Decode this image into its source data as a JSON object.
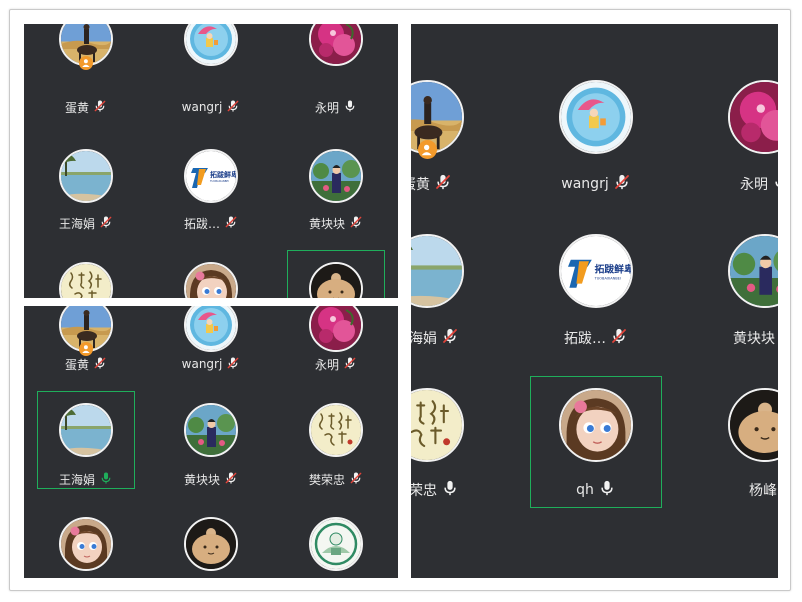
{
  "panels": {
    "top_left": {
      "rows": [
        [
          {
            "name": "蛋黄",
            "avatar": "rider-horse",
            "mic": "muted",
            "badge": true
          },
          {
            "name": "wangrj",
            "avatar": "umbrella-girl",
            "mic": "muted"
          },
          {
            "name": "永明",
            "avatar": "pink-flowers",
            "mic": "on"
          }
        ],
        [
          {
            "name": "王海娟",
            "avatar": "lake-trees",
            "mic": "muted"
          },
          {
            "name": "拓跋…",
            "avatar": "tuoba-logo",
            "mic": "muted"
          },
          {
            "name": "黄块块",
            "avatar": "woman-garden",
            "mic": "muted"
          }
        ],
        [
          {
            "name": "",
            "avatar": "calligraphy",
            "mic": "none"
          },
          {
            "name": "",
            "avatar": "cartoon-girl",
            "mic": "none"
          },
          {
            "name": "",
            "avatar": "clay-doll",
            "mic": "none",
            "speaking": true
          }
        ]
      ]
    },
    "bottom_left": {
      "rows": [
        [
          {
            "name": "蛋黄",
            "avatar": "rider-horse",
            "mic": "muted",
            "badge": true
          },
          {
            "name": "wangrj",
            "avatar": "umbrella-girl",
            "mic": "muted"
          },
          {
            "name": "永明",
            "avatar": "pink-flowers",
            "mic": "muted"
          }
        ],
        [
          {
            "name": "王海娟",
            "avatar": "lake-trees",
            "mic": "active",
            "speaking": true
          },
          {
            "name": "黄块块",
            "avatar": "woman-garden",
            "mic": "muted"
          },
          {
            "name": "樊荣忠",
            "avatar": "calligraphy",
            "mic": "muted"
          }
        ],
        [
          {
            "name": "",
            "avatar": "cartoon-girl",
            "mic": "none"
          },
          {
            "name": "",
            "avatar": "clay-doll",
            "mic": "none"
          },
          {
            "name": "",
            "avatar": "seal-illustration",
            "mic": "none"
          }
        ]
      ]
    },
    "right": {
      "rows": [
        [
          {
            "name": "蛋黄",
            "avatar": "rider-horse",
            "mic": "muted",
            "badge": true
          },
          {
            "name": "wangrj",
            "avatar": "umbrella-girl",
            "mic": "muted"
          },
          {
            "name": "永明",
            "avatar": "pink-flowers",
            "mic": "on"
          }
        ],
        [
          {
            "name": "王海娟",
            "avatar": "lake-trees",
            "mic": "muted"
          },
          {
            "name": "拓跋…",
            "avatar": "tuoba-logo",
            "mic": "muted"
          },
          {
            "name": "黄块块",
            "avatar": "woman-garden",
            "mic": "on"
          }
        ],
        [
          {
            "name": "樊荣忠",
            "avatar": "calligraphy",
            "mic": "on"
          },
          {
            "name": "qh",
            "avatar": "cartoon-girl",
            "mic": "on",
            "speaking": true
          },
          {
            "name": "杨峰",
            "avatar": "clay-doll",
            "mic": "none"
          }
        ]
      ]
    }
  },
  "logo_text": {
    "cn": "拓跋鲜卑",
    "en": "TUOBAXIANBEI"
  },
  "colors": {
    "panel_bg": "#2d2f33",
    "speaking_border": "#1fae5b",
    "muted_red": "#e0433a",
    "badge_orange": "#f39a2b"
  }
}
